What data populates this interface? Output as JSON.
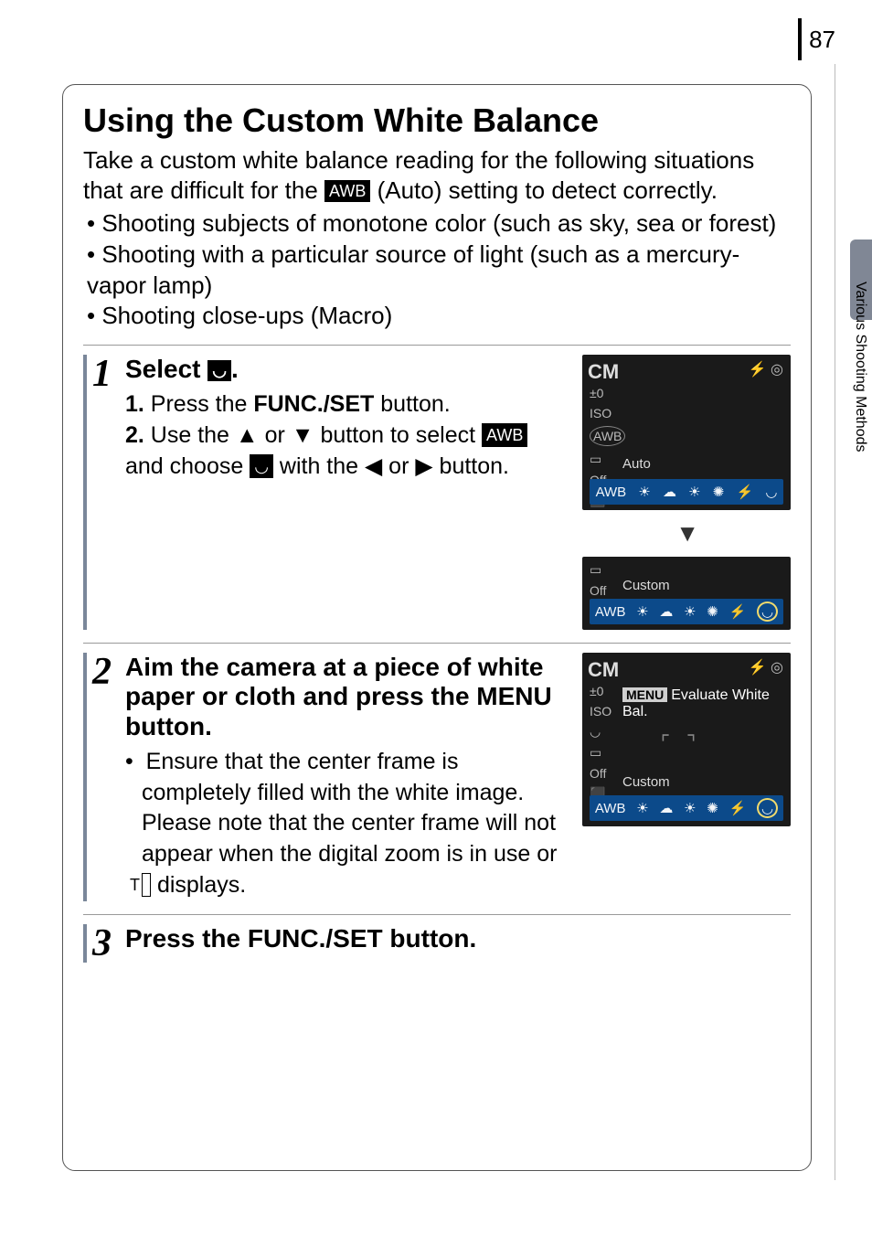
{
  "page_number": "87",
  "side_tab_label": "Various Shooting Methods",
  "title": "Using the Custom White Balance",
  "intro_line1": "Take a custom white balance reading for the following situations that are difficult for the ",
  "intro_awb": "AWB",
  "intro_line2": " (Auto) setting to detect correctly.",
  "bullets": [
    "Shooting subjects of monotone color (such as sky, sea or forest)",
    "Shooting with a particular source of light (such as a mercury-vapor lamp)",
    "Shooting close-ups (Macro)"
  ],
  "steps": {
    "1": {
      "number": "1",
      "title_prefix": "Select ",
      "title_icon": "custom-wb-icon",
      "title_suffix": ".",
      "line1_a": "1.",
      "line1_b": " Press the ",
      "line1_c": "FUNC./SET",
      "line1_d": " button.",
      "line2_a": "2.",
      "line2_b": " Use the ",
      "line2_up": "▲",
      "line2_c": " or ",
      "line2_down": "▼",
      "line2_d": " button to select ",
      "line2_awb": "AWB",
      "line2_e": " and choose ",
      "line2_icon": "custom-wb-icon",
      "line2_f": " with the ",
      "line2_left": "◀",
      "line2_g": " or ",
      "line2_right": "▶",
      "line2_h": " button.",
      "shot_top": {
        "cm": "CM",
        "label": "Auto",
        "row": [
          "AWB",
          "☀",
          "☁",
          "☀",
          "✺",
          "⚡",
          "◡"
        ],
        "left": [
          "±0",
          "ISO",
          "AWB",
          "▭",
          "Off",
          "⬛"
        ]
      },
      "shot_bottom": {
        "label": "Custom",
        "row": [
          "AWB",
          "☀",
          "☁",
          "☀",
          "✺",
          "⚡",
          "◡"
        ],
        "left": [
          "▭",
          "Off",
          "⬛"
        ]
      }
    },
    "2": {
      "number": "2",
      "title": "Aim the camera at a piece of white paper or cloth and press the MENU button.",
      "bullet": "Ensure that the center frame is completely filled with the white image. Please note that the center frame will not appear when the digital zoom is in use or ",
      "bullet_icon": "T",
      "bullet_end": " displays.",
      "shot": {
        "cm": "CM",
        "menu_btn": "MENU",
        "menu_text": "Evaluate White Bal.",
        "label": "Custom",
        "row": [
          "AWB",
          "☀",
          "☁",
          "☀",
          "✺",
          "⚡",
          "◡"
        ],
        "left": [
          "±0",
          "ISO",
          "◡",
          "▭",
          "Off",
          "⬛"
        ]
      }
    },
    "3": {
      "number": "3",
      "title_a": "Press the ",
      "title_b": "FUNC./SET",
      "title_c": " button."
    }
  }
}
